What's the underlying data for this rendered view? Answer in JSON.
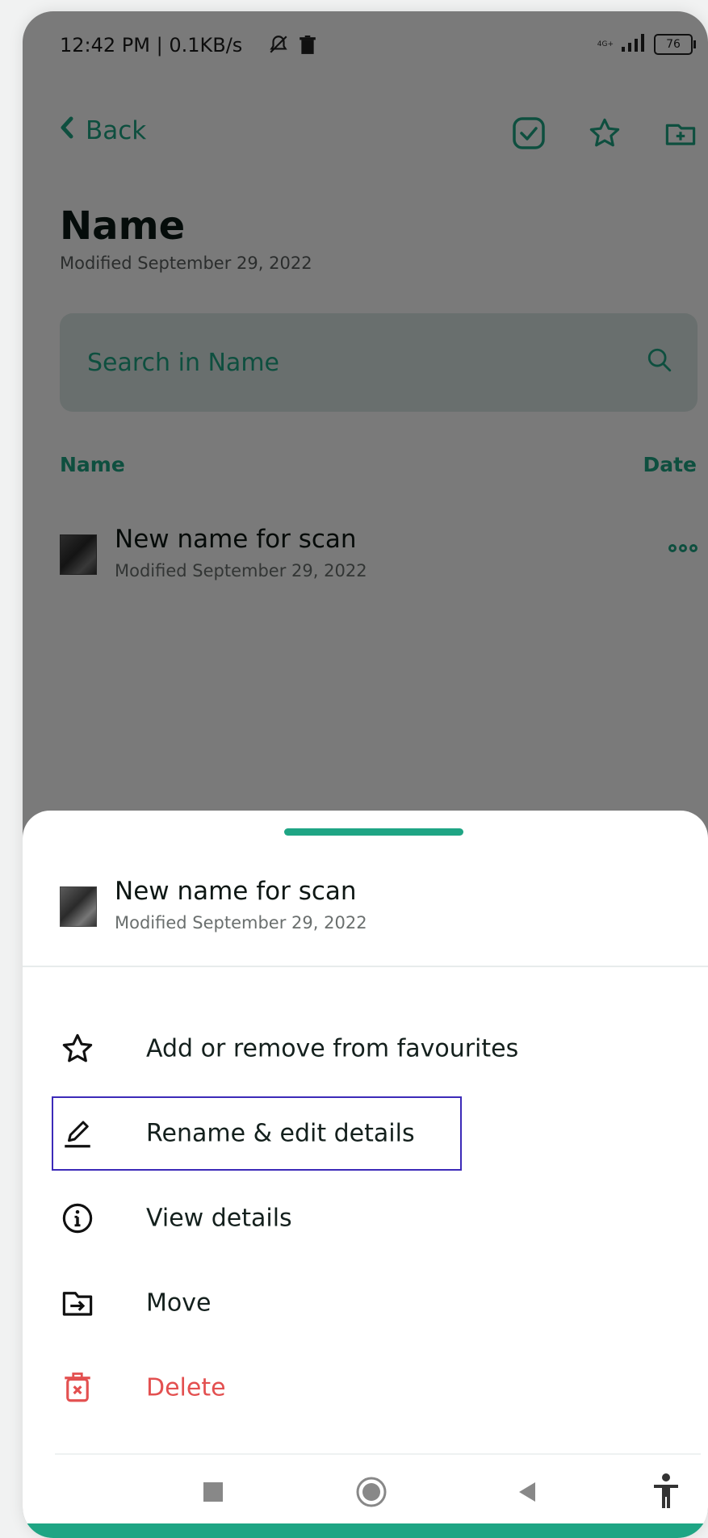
{
  "status_bar": {
    "time_and_speed": "12:42 PM | 0.1KB/s",
    "network": "4G+",
    "battery": "76"
  },
  "topbar": {
    "back_label": "Back",
    "icons": [
      "check-square-icon",
      "star-icon",
      "add-folder-icon"
    ]
  },
  "folder": {
    "title": "Name",
    "modified": "Modified September 29, 2022"
  },
  "search": {
    "placeholder": "Search in Name"
  },
  "list": {
    "col_name": "Name",
    "col_date": "Date",
    "items": [
      {
        "title": "New name for scan",
        "modified": "Modified September 29, 2022"
      }
    ]
  },
  "sheet": {
    "doc": {
      "title": "New name for scan",
      "modified": "Modified September 29, 2022"
    },
    "menu": [
      {
        "label": "Add or remove from favourites",
        "icon": "star-icon"
      },
      {
        "label": "Rename & edit details",
        "icon": "pencil-icon",
        "highlighted": true
      },
      {
        "label": "View details",
        "icon": "info-icon"
      },
      {
        "label": "Move",
        "icon": "move-folder-icon"
      },
      {
        "label": "Delete",
        "icon": "trash-icon",
        "color": "#e35050"
      }
    ]
  },
  "nav": {
    "icons": [
      "recents-icon",
      "home-icon",
      "back-triangle-icon",
      "accessibility-icon"
    ]
  },
  "colors": {
    "accent": "#1fa584",
    "danger": "#e35050",
    "highlight_box": "#3c2ab8"
  }
}
